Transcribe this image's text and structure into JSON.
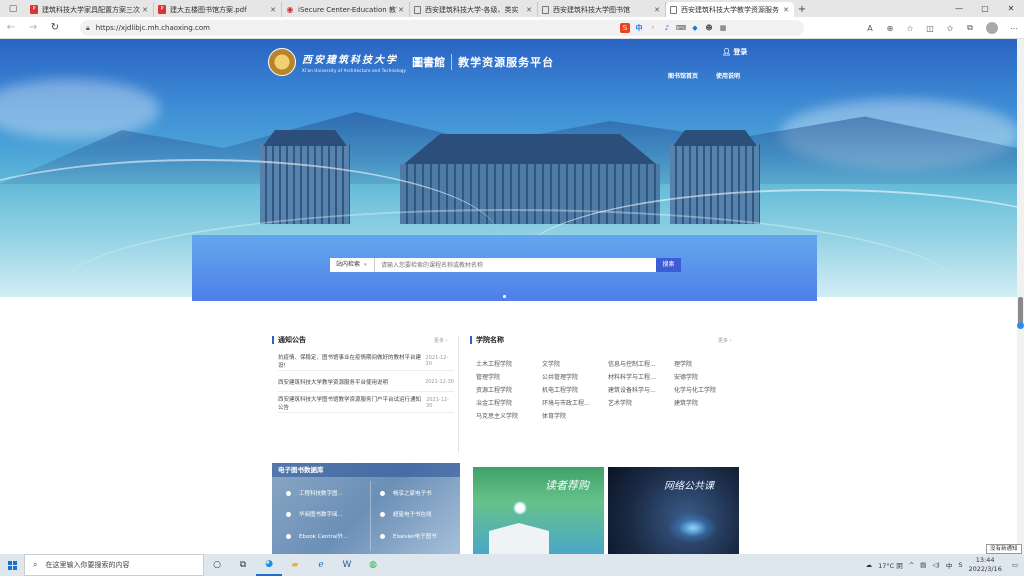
{
  "tabs": [
    {
      "title": "建筑科技大学家具配置方案三次",
      "fav": "pdf"
    },
    {
      "title": "建大五楼图书馆方案.pdf",
      "fav": "pdf"
    },
    {
      "title": "iSecure Center-Education 教育科",
      "fav": "red"
    },
    {
      "title": "西安建筑科技大学-各级、类实",
      "fav": "doc"
    },
    {
      "title": "西安建筑科技大学图书馆",
      "fav": "doc"
    },
    {
      "title": "西安建筑科技大学教学资源服务",
      "fav": "doc",
      "active": true
    }
  ],
  "address": {
    "url": "https://xjdlibjc.mh.chaoxing.com"
  },
  "header": {
    "uni_cn": "西安建筑科技大学",
    "uni_en": "Xi'an University of Architecture and Technology",
    "library": "圖書館",
    "platform": "教学资源服务平台",
    "login": "登录",
    "nav": [
      "图书馆首页",
      "使用说明"
    ]
  },
  "search": {
    "scope": "站内检索",
    "placeholder": "请输入您要检索的课程名称或教材名称",
    "button": "搜索"
  },
  "notice": {
    "title": "通知公告",
    "more": "更多",
    "items": [
      {
        "text": "抗疫情、保稳定、图书馆事业在疫情期间做好的教材平台建设!",
        "date": "2021-12-30"
      },
      {
        "text": "西安建筑科技大学教学资源服务平台使用说明",
        "date": "2021-12-30"
      },
      {
        "text": "西安建筑科技大学图书馆教学资源服务门户平台试运行通知公告",
        "date": "2021-12-30"
      }
    ]
  },
  "college": {
    "title": "学院名称",
    "more": "更多",
    "items": [
      "土木工程学院",
      "文学院",
      "信息与控制工程...",
      "理学院",
      "管理学院",
      "公共管理学院",
      "材料科学与工程...",
      "安德学院",
      "资源工程学院",
      "机电工程学院",
      "建筑设备科学与...",
      "化学与化工学院",
      "冶金工程学院",
      "环境与市政工程...",
      "艺术学院",
      "建筑学院",
      "马克思主义学院",
      "体育学院"
    ]
  },
  "ebook": {
    "title": "电子图书数据库",
    "links": [
      "工程科技数字图...",
      "畅享之家电子书",
      "华阅图书数字阅...",
      "超星电子书在线",
      "Ebook Central外...",
      "Elsevier电子图书"
    ]
  },
  "banners": {
    "reader": "读者荐购",
    "course": "网络公共课"
  },
  "tooltip": "没有新通知",
  "taskbar": {
    "search_placeholder": "在这里输入你要搜索的内容",
    "weather": "17°C 阴",
    "ime": "中",
    "time": "13:44",
    "date": "2022/3/16"
  }
}
